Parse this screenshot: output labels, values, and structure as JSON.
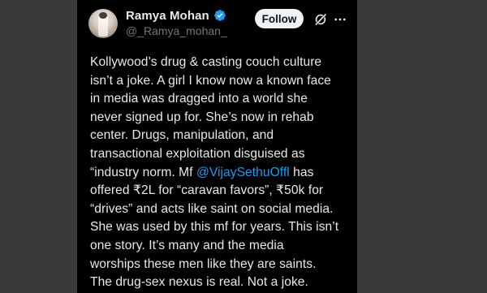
{
  "post": {
    "author": {
      "display_name": "Ramya Mohan",
      "handle": "@_Ramya_mohan_",
      "verified": true,
      "verified_color": "#1d9bf0"
    },
    "follow_label": "Follow",
    "icons": {
      "grok": "grok-icon",
      "more": "more-icon"
    },
    "body_lines": [
      "Kollywood’s drug & casting couch culture",
      "isn’t a joke. A girl I know now a known face",
      "in media was dragged into a world she",
      "never signed up for. She’s now in  rehab",
      "center. Drugs, manipulation, and",
      "transactional exploitation disguised as",
      "“industry norm. Mf ",
      "offered ₹2L for “caravan favors”, ₹50k for",
      "“drives” and acts like saint on social media.",
      "She was used by this mf for years. This isn’t",
      "one story. It’s many and the media",
      "worships these men like they are saints.",
      "The drug-sex nexus is real. Not a joke."
    ],
    "mention": "@VijaySethuOffl",
    "mention_suffix": " has",
    "colors": {
      "background": "#000000",
      "text": "#e7e9ea",
      "secondary_text": "#71767b",
      "link": "#1d9bf0",
      "follow_button_bg": "#eff3f4",
      "page_bg": "#3a3a3a"
    }
  }
}
